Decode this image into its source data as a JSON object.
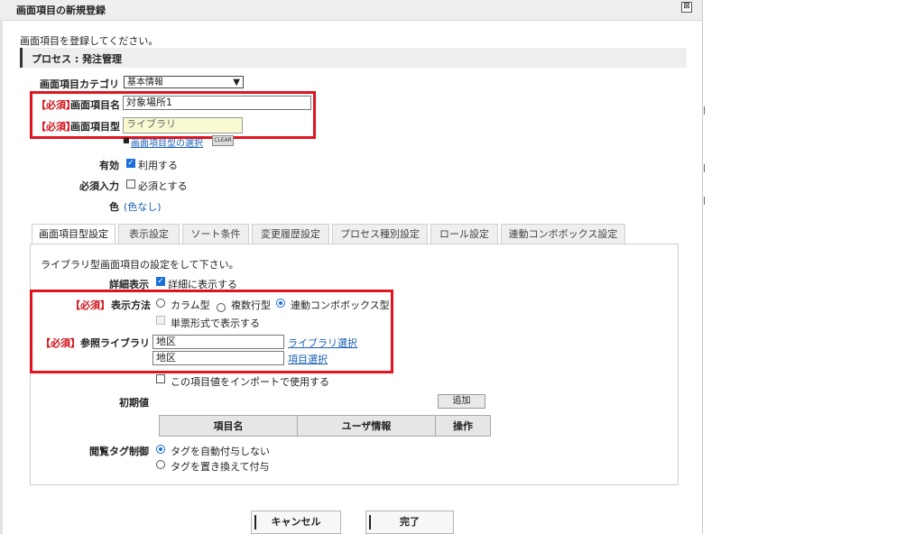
{
  "dialog": {
    "title": "画面項目の新規登録",
    "close_symbol": "⊠",
    "intro": "画面項目を登録してください。",
    "process_label": "プロセス : 発注管理"
  },
  "form": {
    "category_label": "画面項目カテゴリ",
    "category_value": "基本情報",
    "required_tag": "【必須】",
    "name_label": "画面項目名",
    "name_value": "対象場所1",
    "type_label": "画面項目型",
    "type_value": "ライブラリ",
    "type_select_link": "画面項目型の選択",
    "clear_label": "CLEAR",
    "enabled_label": "有効",
    "enabled_option": "利用する",
    "enabled_checked": true,
    "required_input_label": "必須入力",
    "required_input_option": "必須とする",
    "required_input_checked": false,
    "color_label": "色",
    "color_value": "(色なし)"
  },
  "tabs": [
    {
      "label": "画面項目型設定",
      "active": true
    },
    {
      "label": "表示設定",
      "active": false
    },
    {
      "label": "ソート条件",
      "active": false
    },
    {
      "label": "変更履歴設定",
      "active": false
    },
    {
      "label": "プロセス種別設定",
      "active": false
    },
    {
      "label": "ロール設定",
      "active": false
    },
    {
      "label": "連動コンボボックス設定",
      "active": false
    }
  ],
  "panel": {
    "intro": "ライブラリ型画面項目の設定をして下さい。",
    "detail_label": "詳細表示",
    "detail_option": "詳細に表示する",
    "display_label": "表示方法",
    "display_options": [
      "カラム型",
      "複数行型",
      "連動コンボボックス型"
    ],
    "display_selected": "連動コンボボックス型",
    "single_form_option": "単票形式で表示する",
    "ref_library_label": "参照ライブラリ",
    "ref_library_value": "地区",
    "ref_library_link": "ライブラリ選択",
    "ref_item_value": "地区",
    "ref_item_link": "項目選択",
    "import_option": "この項目値をインポートで使用する",
    "initial_label": "初期値",
    "add_button": "追加",
    "columns": [
      "項目名",
      "ユーザ情報",
      "操作"
    ],
    "view_tag_label": "閲覧タグ制御",
    "view_tag_options": [
      "タグを自動付与しない",
      "タグを置き換えて付与"
    ],
    "view_tag_selected": "タグを自動付与しない"
  },
  "footer": {
    "cancel_button": "キャンセル",
    "done_button": "完了"
  },
  "colors": {
    "required_red": "#d0121b",
    "highlight_box": "#e0141e",
    "link_blue": "#1a5fb4",
    "accent_blue": "#1a6fd8"
  }
}
